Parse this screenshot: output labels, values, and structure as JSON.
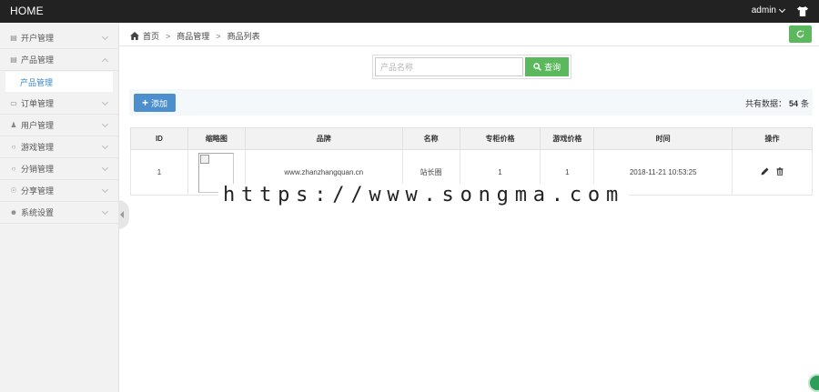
{
  "topbar": {
    "brand": "HOME",
    "user": "admin",
    "icon": "shirt-icon"
  },
  "sidebar": {
    "items": [
      {
        "label": "开户管理",
        "icon": "list-icon"
      },
      {
        "label": "产品管理",
        "icon": "list-icon",
        "sub": "产品管理"
      },
      {
        "label": "订单管理",
        "icon": "card-icon"
      },
      {
        "label": "用户管理",
        "icon": "user-icon"
      },
      {
        "label": "游戏管理",
        "icon": "chat-icon"
      },
      {
        "label": "分销管理",
        "icon": "chat-icon"
      },
      {
        "label": "分享管理",
        "icon": "share-icon"
      },
      {
        "label": "系统设置",
        "icon": "person-icon"
      }
    ]
  },
  "breadcrumb": {
    "home": "首页",
    "level2": "商品管理",
    "level3": "商品列表"
  },
  "search": {
    "placeholder": "产品名称",
    "button": "查询"
  },
  "toolbar": {
    "add_label": "添加",
    "total_prefix": "共有数据：",
    "total_count": "54",
    "total_suffix": "条"
  },
  "table": {
    "headers": [
      "ID",
      "缩略图",
      "品牌",
      "名称",
      "专柜价格",
      "游戏价格",
      "时间",
      "操作"
    ],
    "rows": [
      {
        "id": "1",
        "brand": "www.zhanzhangquan.cn",
        "name": "站长圈",
        "counter_price": "1",
        "game_price": "1",
        "time": "2018-11-21 10:53:25"
      }
    ]
  },
  "watermark": "https://www.songma.com",
  "colors": {
    "accent": "#4d8fcc",
    "success": "#5cb85c",
    "topbar": "#222222"
  }
}
